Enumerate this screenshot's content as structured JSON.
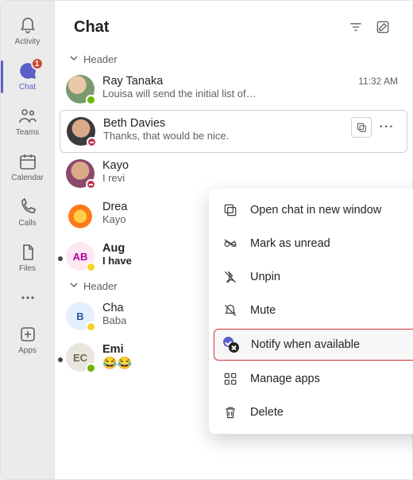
{
  "rail": {
    "activity": "Activity",
    "chat": "Chat",
    "chat_badge": "1",
    "teams": "Teams",
    "calendar": "Calendar",
    "calls": "Calls",
    "files": "Files",
    "apps": "Apps"
  },
  "header": {
    "title": "Chat"
  },
  "sections": {
    "header_label": "Header"
  },
  "chats": [
    {
      "name": "Ray Tanaka",
      "time": "11:32 AM",
      "preview": "Louisa will send the initial list of…"
    },
    {
      "name": "Beth Davies",
      "time": "",
      "preview": "Thanks, that would be nice."
    },
    {
      "name": "Kayo",
      "time": "",
      "preview": "I revi"
    },
    {
      "name": "Drea",
      "time": "",
      "preview": "Kayo"
    },
    {
      "name": "Aug",
      "time": "",
      "preview": "I have"
    },
    {
      "name": "Cha",
      "time": "",
      "preview": "Baba"
    },
    {
      "name": "Emi",
      "time": "",
      "preview": "😂😂"
    }
  ],
  "avatars": {
    "ab": "AB",
    "b": "B",
    "ec": "EC"
  },
  "menu": {
    "open_new": "Open chat in new window",
    "mark_unread": "Mark as unread",
    "unpin": "Unpin",
    "mute": "Mute",
    "notify": "Notify when available",
    "manage_apps": "Manage apps",
    "delete": "Delete"
  }
}
